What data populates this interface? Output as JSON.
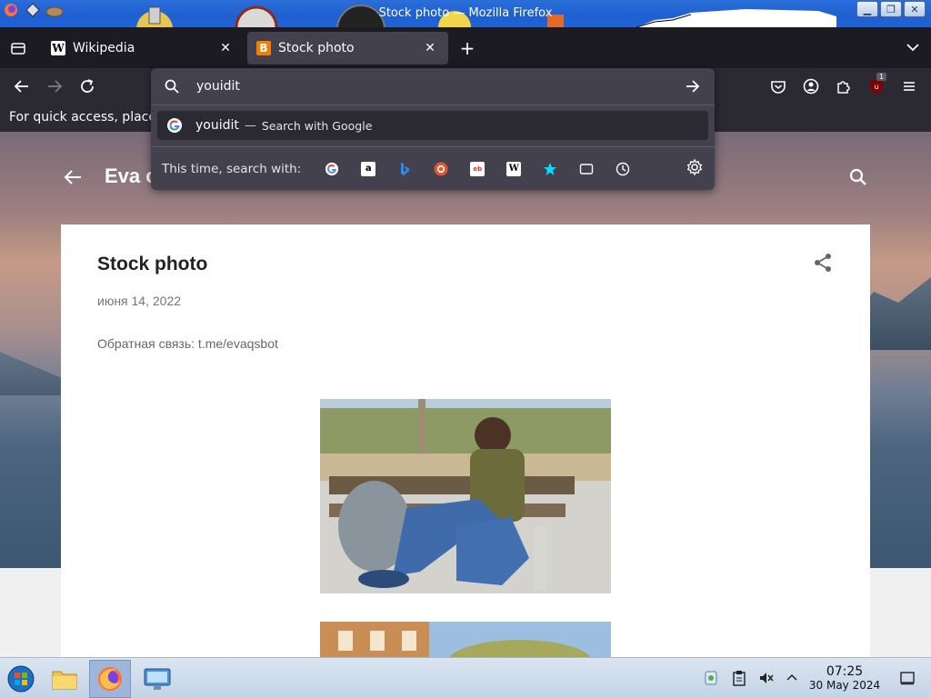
{
  "window": {
    "title": "Stock photo — Mozilla Firefox",
    "controls": [
      "minimize",
      "maximize",
      "close"
    ]
  },
  "tabs": [
    {
      "label": "Wikipedia",
      "favicon": "wikipedia-icon",
      "active": false
    },
    {
      "label": "Stock photo",
      "favicon": "blogger-icon",
      "active": true
    }
  ],
  "urlbar": {
    "value": "youidit",
    "suggestion": {
      "term": "youidit",
      "separator": "—",
      "action": "Search with Google"
    },
    "oneoff_label": "This time, search with:",
    "engines": [
      "google",
      "amazon",
      "bing",
      "duckduckgo",
      "ebay",
      "wikipedia",
      "bookmarks",
      "tabs",
      "history"
    ]
  },
  "bookmarks_bar": {
    "text": "For quick access, place"
  },
  "blog": {
    "title": "Eva c",
    "post_title": "Stock photo",
    "date": "июня 14, 2022",
    "body": "Обратная связь: t.me/evaqsbot"
  },
  "toolbar": {
    "extension_badge": "1"
  },
  "taskbar": {
    "time": "07:25",
    "date": "30 May 2024"
  },
  "colors": {
    "tab_strip": "#1c1b22",
    "nav_bar": "#2b2a33",
    "active_tab": "#42414d",
    "urlbar_popup": "#42414d",
    "titlebar": "#2164d6",
    "taskbar": "#c3d3e6"
  }
}
